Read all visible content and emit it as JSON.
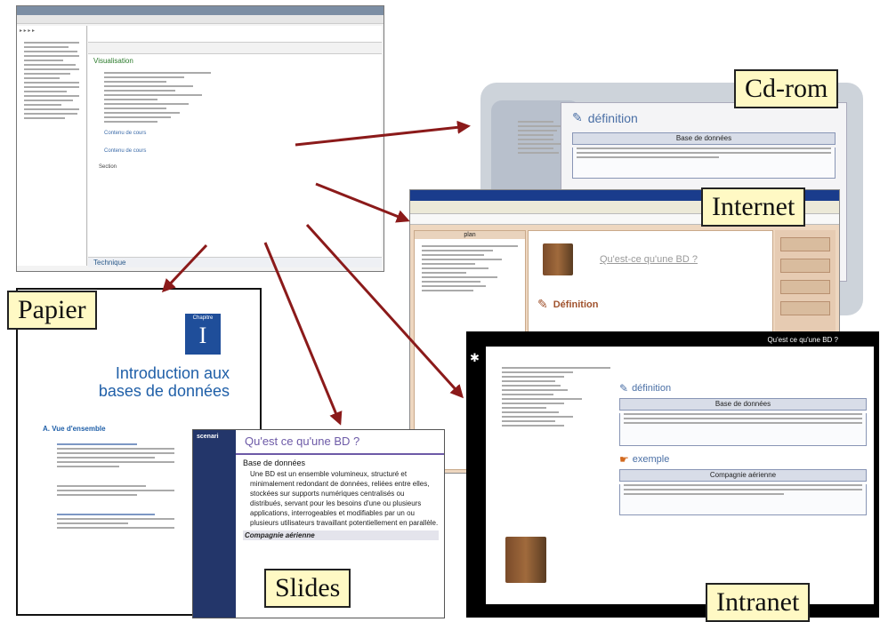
{
  "labels": {
    "cdrom": "Cd-rom",
    "internet": "Internet",
    "papier": "Papier",
    "slides": "Slides",
    "intranet": "Intranet"
  },
  "editor": {
    "main_tab_label": "Visualisation",
    "footer_section": "Technique",
    "notes": [
      "Contenu de cours",
      "Contenu de cours"
    ],
    "section_label": "Section"
  },
  "cdrom": {
    "heading": "définition",
    "box_title": "Base de données"
  },
  "internet": {
    "page_title": "Qu'est-ce qu'une BD ?",
    "section": "Définition",
    "left_header": "plan",
    "right_buttons": [
      "",
      "",
      "",
      ""
    ]
  },
  "paper": {
    "chapter_badge_label": "Chapitre",
    "chapter_number": "I",
    "title_line1": "Introduction aux",
    "title_line2": "bases de données",
    "subhead": "A. Vue d'ensemble"
  },
  "slides": {
    "logo": "scenari",
    "title": "Qu'est ce qu'une BD ?",
    "section": "Base de données",
    "body": "Une BD est un ensemble volumineux, structuré et minimalement redondant de données, reliées entre elles, stockées sur supports numériques centralisés ou distribués, servant pour les besoins d'une ou plusieurs applications, interrogeables et modifiables par un ou plusieurs utilisateurs travaillant potentiellement en parallèle.",
    "footer": "Compagnie aérienne"
  },
  "intranet": {
    "header": "Qu'est ce qu'une BD ?",
    "definition_heading": "définition",
    "box1_title": "Base de données",
    "example_heading": "exemple",
    "box2_title": "Compagnie aérienne"
  },
  "colors": {
    "arrow": "#8b1a1a",
    "label_bg": "#fff9c4",
    "paper_badge": "#1f4e9a",
    "paper_title": "#1f5fa8",
    "slide_band": "#23366a",
    "slide_accent": "#6d5aa7"
  }
}
